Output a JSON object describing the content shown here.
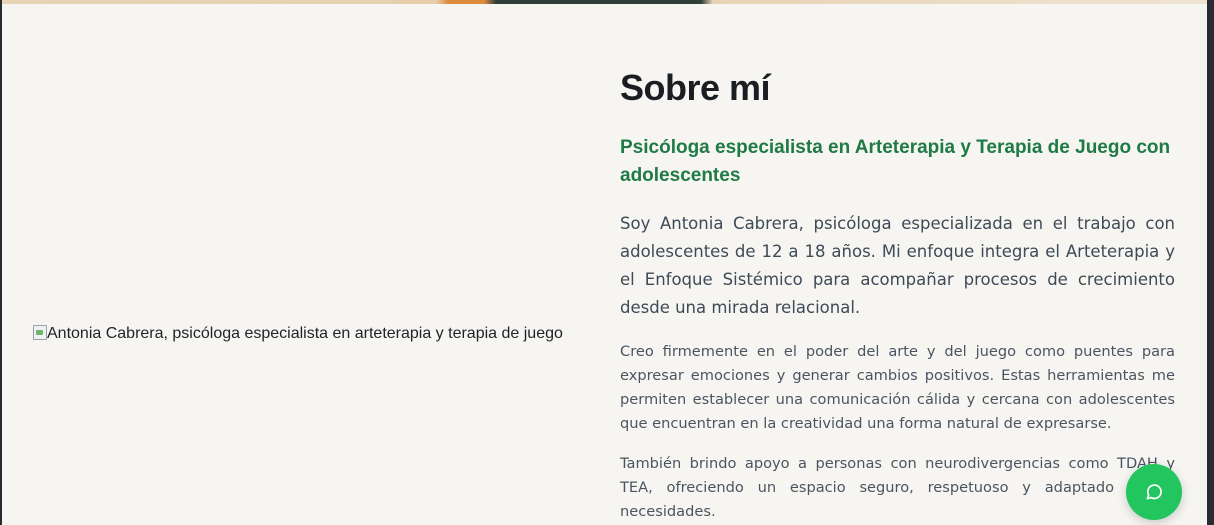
{
  "image": {
    "alt": "Antonia Cabrera, psicóloga especialista en arteterapia y terapia de juego",
    "icon": "broken-image-icon"
  },
  "about": {
    "title": "Sobre mí",
    "subtitle": "Psicóloga especialista en Arteterapia y Terapia de Juego con adolescentes",
    "lead": "Soy Antonia Cabrera, psicóloga especializada en el trabajo con adolescentes de 12 a 18 años. Mi enfoque integra el Arteterapia y el Enfoque Sistémico para acompañar procesos de crecimiento desde una mirada relacional.",
    "paragraph_1": "Creo firmemente en el poder del arte y del juego como puentes para expresar emociones y generar cambios positivos. Estas herramientas me permiten establecer una comunicación cálida y cercana con adolescentes que encuentran en la creatividad una forma natural de expresarse.",
    "paragraph_2": "También brindo apoyo a personas con neurodivergencias como TDAH y TEA, ofreciendo un espacio seguro, respetuoso y adaptado a sus necesidades."
  },
  "chat_button": {
    "icon": "chat-bubble-icon",
    "color": "#22c55e"
  },
  "colors": {
    "accent_green": "#1f7a45",
    "background": "#f6f5f2"
  }
}
